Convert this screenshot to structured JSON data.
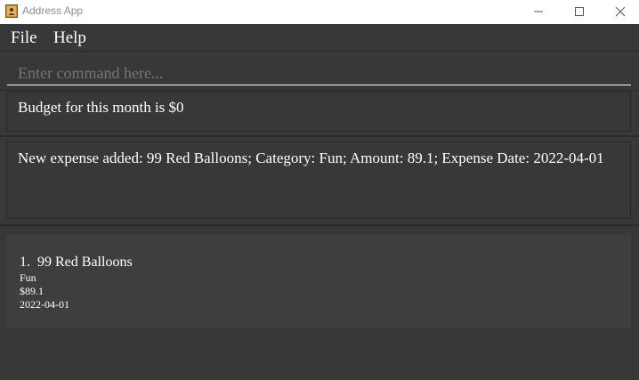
{
  "window": {
    "title": "Address App",
    "icon": "address-book-icon",
    "controls": [
      "minimize-icon",
      "maximize-icon",
      "close-icon"
    ]
  },
  "menu": {
    "file": "File",
    "help": "Help"
  },
  "command": {
    "placeholder": "Enter command here...",
    "value": ""
  },
  "budget": {
    "text": "Budget for this month is $0"
  },
  "result": {
    "text": "New expense added: 99 Red Balloons; Category: Fun; Amount: 89.1; Expense Date: 2022-04-01"
  },
  "expenses": [
    {
      "index": "1.",
      "name": "99 Red Balloons",
      "category": "Fun",
      "amount": "$89.1",
      "date": "2022-04-01"
    }
  ],
  "colors": {
    "background": "#383838",
    "card": "#3c3e3f",
    "border": "#2a2a2a",
    "text": "#ffffff",
    "titlebar": "#ffffff"
  }
}
